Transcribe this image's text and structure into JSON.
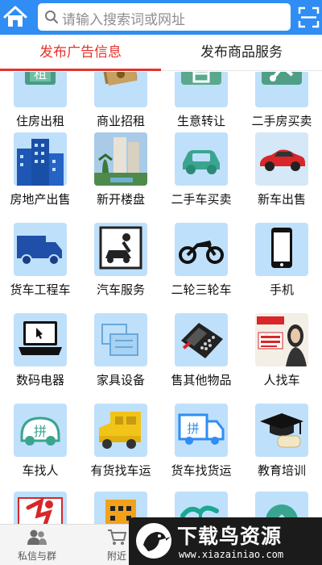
{
  "search": {
    "placeholder": "请输入搜索词或网址"
  },
  "tabs": [
    {
      "label": "发布广告信息",
      "active": true
    },
    {
      "label": "发布商品服务",
      "active": false
    }
  ],
  "categories": [
    {
      "label": "住房出租",
      "icon": "house-rent-icon"
    },
    {
      "label": "商业招租",
      "icon": "cash-icon"
    },
    {
      "label": "生意转让",
      "icon": "shop-transfer-icon"
    },
    {
      "label": "二手房买卖",
      "icon": "house-trade-icon"
    },
    {
      "label": "房地产出售",
      "icon": "buildings-icon"
    },
    {
      "label": "新开楼盘",
      "icon": "new-estate-photo-icon"
    },
    {
      "label": "二手车买卖",
      "icon": "car-icon"
    },
    {
      "label": "新车出售",
      "icon": "red-sports-car-icon"
    },
    {
      "label": "货车工程车",
      "icon": "truck-icon"
    },
    {
      "label": "汽车服务",
      "icon": "car-repair-icon"
    },
    {
      "label": "二轮三轮车",
      "icon": "motorcycle-icon"
    },
    {
      "label": "手机",
      "icon": "mobile-phone-icon"
    },
    {
      "label": "数码电器",
      "icon": "laptop-icon"
    },
    {
      "label": "家具设备",
      "icon": "furniture-icon"
    },
    {
      "label": "售其他物品",
      "icon": "pos-terminal-icon"
    },
    {
      "label": "人找车",
      "icon": "carpool-poster-icon"
    },
    {
      "label": "车找人",
      "icon": "carpool-icon"
    },
    {
      "label": "有货找车运",
      "icon": "loaded-truck-icon"
    },
    {
      "label": "货车找货运",
      "icon": "carpool-truck-icon"
    },
    {
      "label": "教育培训",
      "icon": "graduation-cap-icon"
    },
    {
      "label": "",
      "icon": "dance-icon"
    },
    {
      "label": "",
      "icon": "hotel-icon"
    },
    {
      "label": "",
      "icon": "palm-tree-icon"
    },
    {
      "label": "",
      "icon": "diamond-icon"
    }
  ],
  "bottom_nav": [
    {
      "label": "私信与群",
      "icon": "group-chat-icon"
    },
    {
      "label": "附近",
      "icon": "cart-icon"
    }
  ],
  "watermark": {
    "title": "下载鸟资源",
    "url": "www.xiazainiao.com"
  },
  "colors": {
    "accent_blue": "#2f8df3",
    "tab_active": "#e5322b",
    "tile_bg": "#bfe0fb"
  }
}
